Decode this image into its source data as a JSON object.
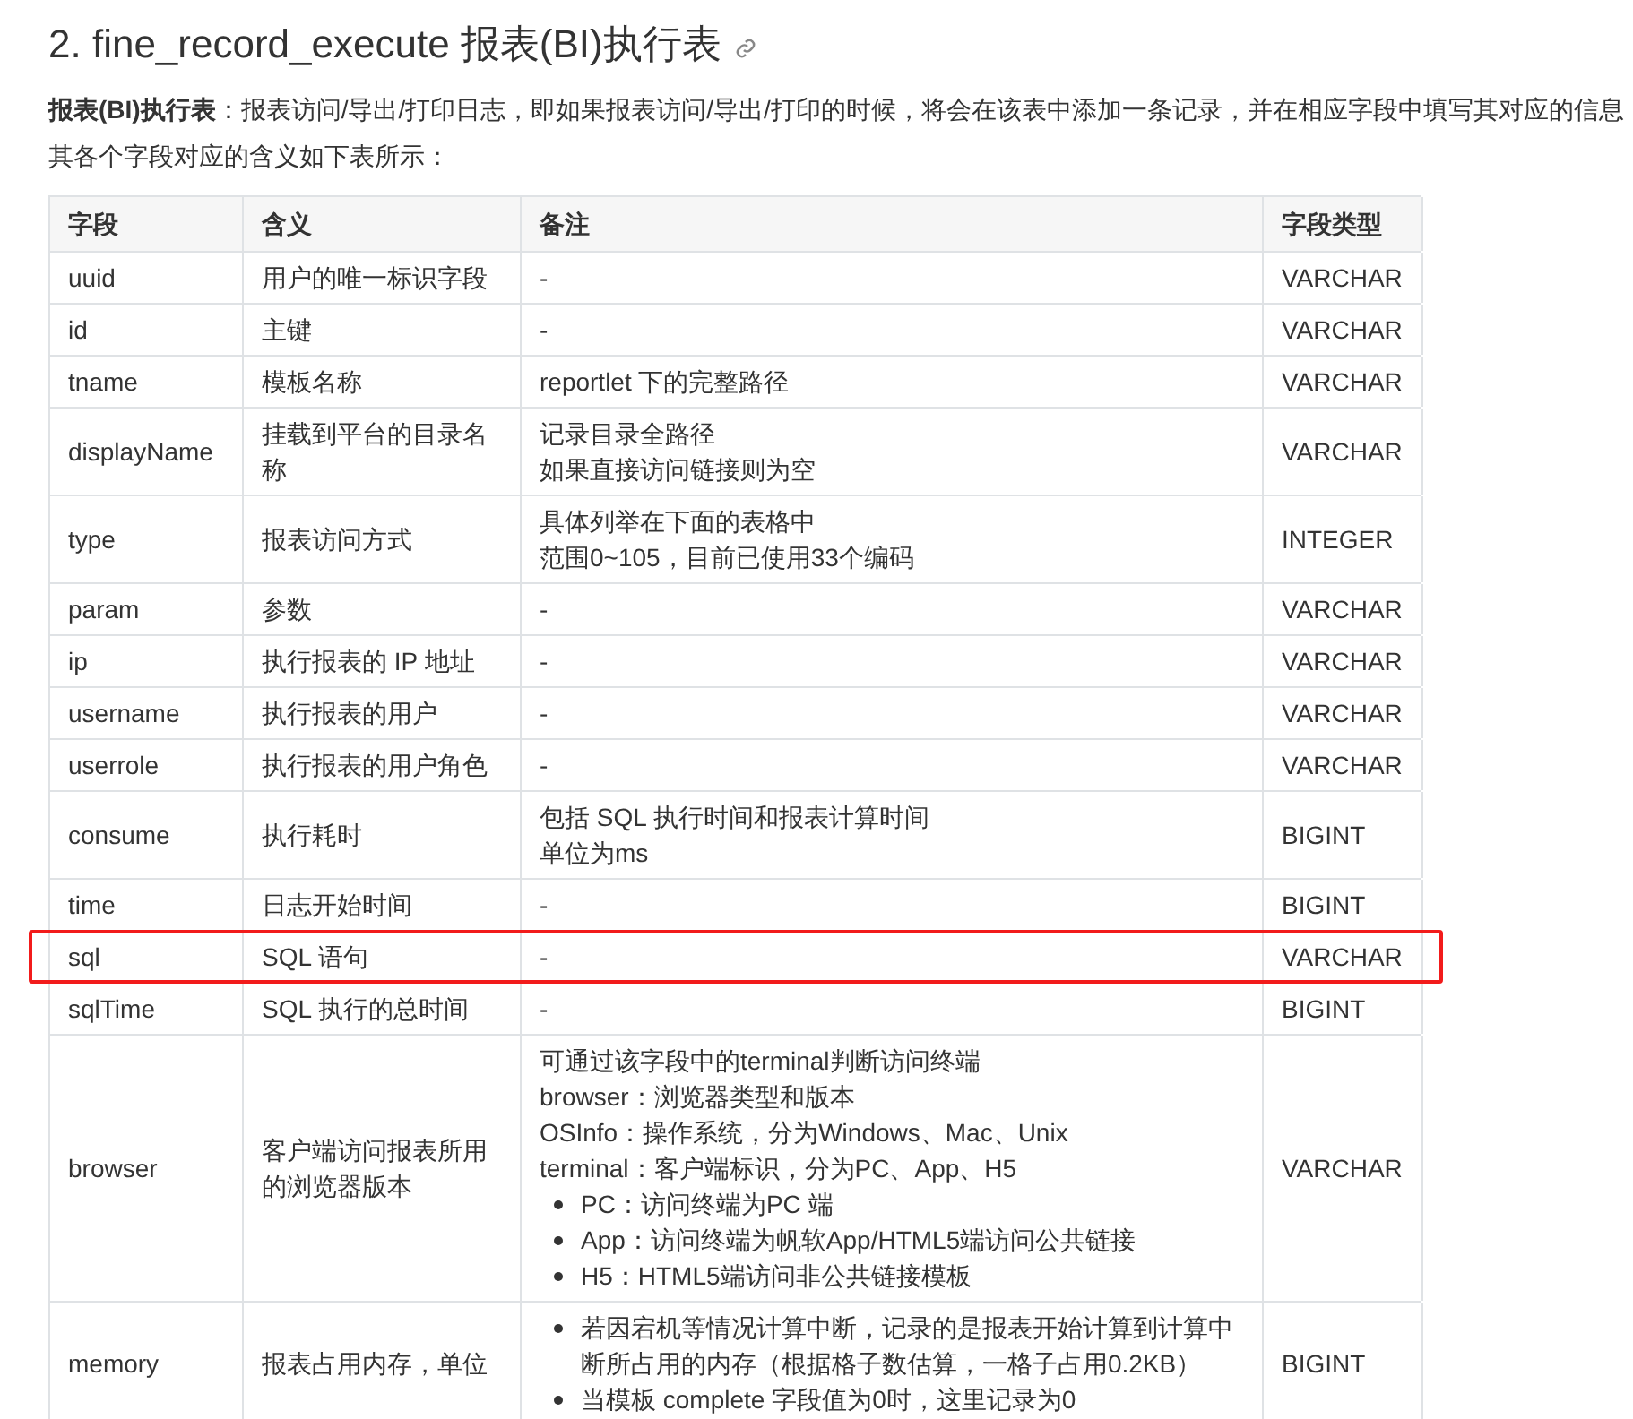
{
  "heading": "2. fine_record_execute 报表(BI)执行表",
  "intro": "**报表(BI)执行表**：报表访问/导出/打印日志，即如果报表访问/导出/打印的时候，将会在该表中添加一条记录，并在相应字段中填写其对应的信息",
  "lead": "其各个字段对应的含义如下表所示：",
  "table": {
    "columns": [
      "字段",
      "含义",
      "备注",
      "字段类型"
    ],
    "rows": [
      {
        "field": "uuid",
        "meaning": "用户的唯一标识字段",
        "notes": [
          {
            "kind": "line",
            "text": "-"
          }
        ],
        "type": "VARCHAR",
        "highlighted": false
      },
      {
        "field": "id",
        "meaning": "主键",
        "notes": [
          {
            "kind": "line",
            "text": "-"
          }
        ],
        "type": "VARCHAR",
        "highlighted": false
      },
      {
        "field": "tname",
        "meaning": "模板名称",
        "notes": [
          {
            "kind": "line",
            "text": "reportlet 下的完整路径"
          }
        ],
        "type": "VARCHAR",
        "highlighted": false
      },
      {
        "field": "displayName",
        "meaning": "挂载到平台的目录名称",
        "notes": [
          {
            "kind": "line",
            "text": "记录目录全路径"
          },
          {
            "kind": "line",
            "text": "如果直接访问链接则为空"
          }
        ],
        "type": "VARCHAR",
        "highlighted": false
      },
      {
        "field": "type",
        "meaning": "报表访问方式",
        "notes": [
          {
            "kind": "line",
            "text": "具体列举在下面的表格中"
          },
          {
            "kind": "line",
            "text": "范围0~105，目前已使用33个编码"
          }
        ],
        "type": "INTEGER",
        "highlighted": false
      },
      {
        "field": "param",
        "meaning": "参数",
        "notes": [
          {
            "kind": "line",
            "text": "-"
          }
        ],
        "type": "VARCHAR",
        "highlighted": false
      },
      {
        "field": "ip",
        "meaning": "执行报表的 IP 地址",
        "notes": [
          {
            "kind": "line",
            "text": "-"
          }
        ],
        "type": "VARCHAR",
        "highlighted": false
      },
      {
        "field": "username",
        "meaning": "执行报表的用户",
        "notes": [
          {
            "kind": "line",
            "text": "-"
          }
        ],
        "type": "VARCHAR",
        "highlighted": false
      },
      {
        "field": "userrole",
        "meaning": "执行报表的用户角色",
        "notes": [
          {
            "kind": "line",
            "text": "-"
          }
        ],
        "type": "VARCHAR",
        "highlighted": false
      },
      {
        "field": "consume",
        "meaning": "执行耗时",
        "notes": [
          {
            "kind": "line",
            "text": "包括 SQL 执行时间和报表计算时间"
          },
          {
            "kind": "line",
            "text": "单位为ms"
          }
        ],
        "type": "BIGINT",
        "highlighted": false
      },
      {
        "field": "time",
        "meaning": "日志开始时间",
        "notes": [
          {
            "kind": "line",
            "text": "-"
          }
        ],
        "type": "BIGINT",
        "highlighted": false
      },
      {
        "field": "sql",
        "meaning": "SQL 语句",
        "notes": [
          {
            "kind": "line",
            "text": "-"
          }
        ],
        "type": "VARCHAR",
        "highlighted": true
      },
      {
        "field": "sqlTime",
        "meaning": "SQL 执行的总时间",
        "notes": [
          {
            "kind": "line",
            "text": "-"
          }
        ],
        "type": "BIGINT",
        "highlighted": false
      },
      {
        "field": "browser",
        "meaning": "客户端访问报表所用的浏览器版本",
        "notes": [
          {
            "kind": "line",
            "text": "可通过该字段中的terminal判断访问终端"
          },
          {
            "kind": "line",
            "text": "browser：浏览器类型和版本"
          },
          {
            "kind": "line",
            "text": "OSInfo：操作系统，分为Windows、Mac、Unix"
          },
          {
            "kind": "line",
            "text": "terminal：客户端标识，分为PC、App、H5"
          },
          {
            "kind": "bullet",
            "text": "PC：访问终端为PC 端"
          },
          {
            "kind": "bullet",
            "text": "App：访问终端为帆软App/HTML5端访问公共链接"
          },
          {
            "kind": "bullet",
            "text": "H5：HTML5端访问非公共链接模板"
          }
        ],
        "type": "VARCHAR",
        "highlighted": false
      },
      {
        "field": "memory",
        "meaning": "报表占用内存，单位",
        "notes": [
          {
            "kind": "bullet",
            "text": "若因宕机等情况计算中断，记录的是报表开始计算到计算中断所占用的内存（根据格子数估算，一格子占用0.2KB）"
          },
          {
            "kind": "bullet",
            "text": "当模板 complete 字段值为0时，这里记录为0"
          }
        ],
        "type": "BIGINT",
        "highlighted": false
      }
    ]
  }
}
